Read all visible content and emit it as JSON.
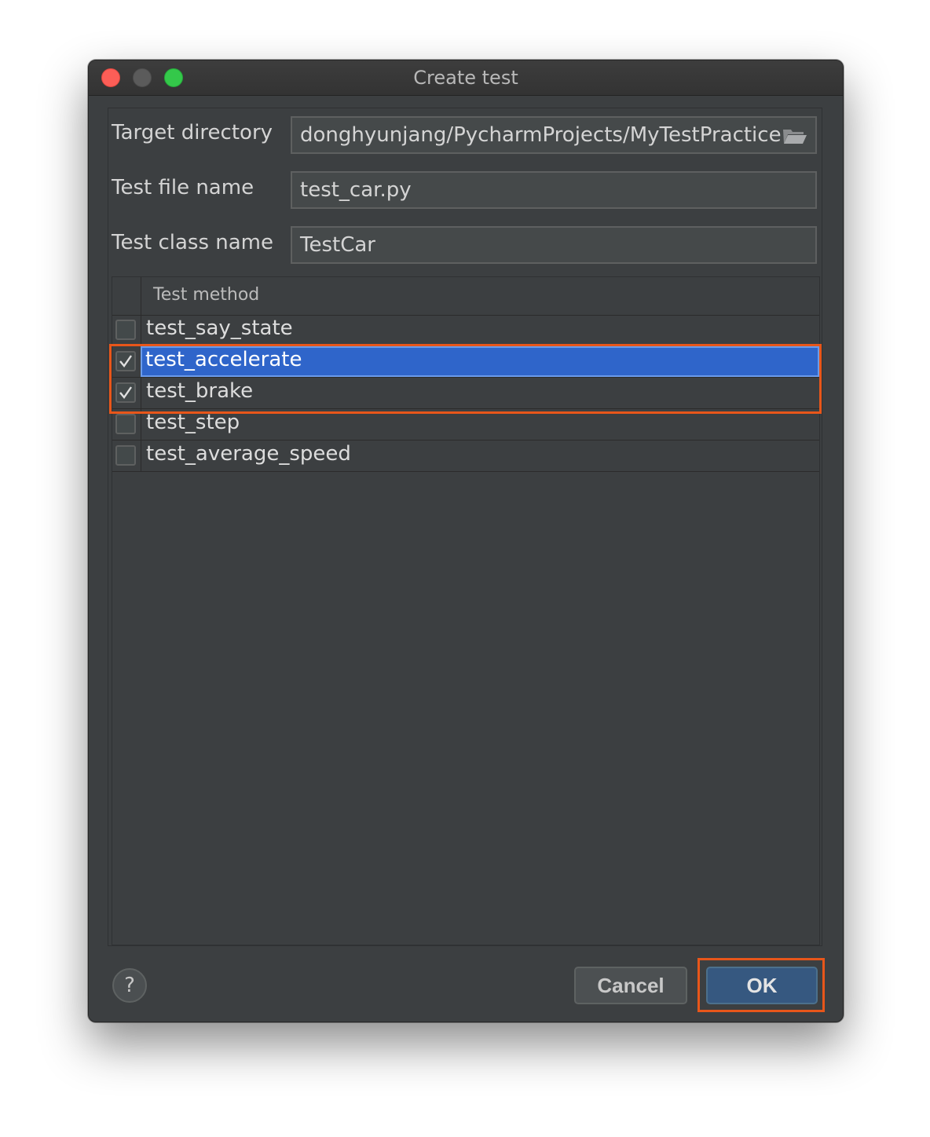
{
  "window": {
    "title": "Create test"
  },
  "form": {
    "target_directory_label": "Target directory",
    "target_directory_value": "donghyunjang/PycharmProjects/MyTestPractice",
    "test_file_label": "Test file name",
    "test_file_value": "test_car.py",
    "test_class_label": "Test class name",
    "test_class_value": "TestCar"
  },
  "table": {
    "header": "Test method",
    "rows": [
      {
        "name": "test_say_state",
        "checked": false,
        "selected": false
      },
      {
        "name": "test_accelerate",
        "checked": true,
        "selected": true
      },
      {
        "name": "test_brake",
        "checked": true,
        "selected": false
      },
      {
        "name": "test_step",
        "checked": false,
        "selected": false
      },
      {
        "name": "test_average_speed",
        "checked": false,
        "selected": false
      }
    ]
  },
  "footer": {
    "help_symbol": "?",
    "cancel_label": "Cancel",
    "ok_label": "OK"
  },
  "icons": {
    "folder": "folder-icon",
    "help": "help-icon",
    "checkmark": "checkmark-icon"
  },
  "colors": {
    "selection": "#2f65ca",
    "annotation_highlight": "#e8561a",
    "ok_button": "#365880"
  }
}
